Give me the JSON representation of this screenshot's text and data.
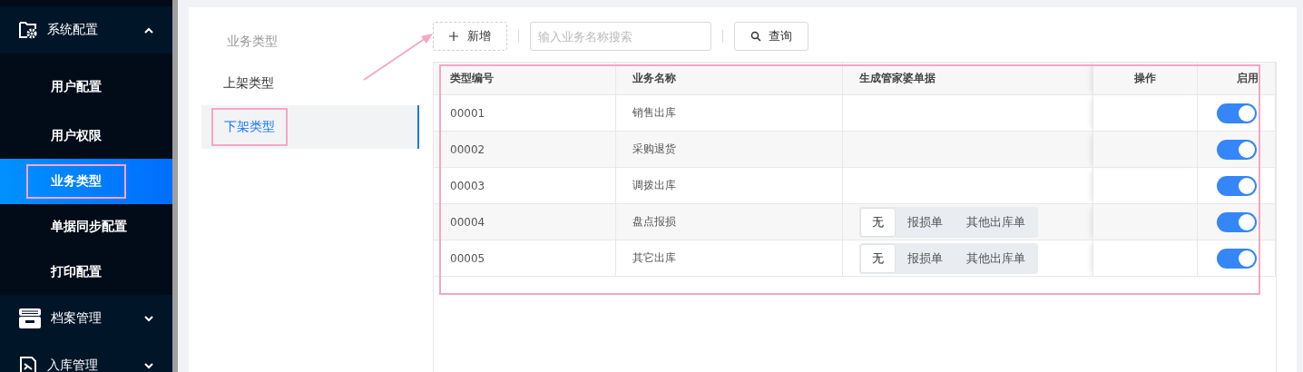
{
  "sidebar": {
    "groups": [
      {
        "label": "系统配置",
        "expanded": true,
        "children": [
          {
            "label": "用户配置",
            "selected": false,
            "highlighted": false
          },
          {
            "label": "用户权限",
            "selected": false,
            "highlighted": false
          },
          {
            "label": "业务类型",
            "selected": true,
            "highlighted": true
          },
          {
            "label": "单据同步配置",
            "selected": false,
            "highlighted": false
          },
          {
            "label": "打印配置",
            "selected": false,
            "highlighted": false
          }
        ]
      },
      {
        "label": "档案管理",
        "expanded": false
      },
      {
        "label": "入库管理",
        "expanded": false
      }
    ]
  },
  "submenu": {
    "title": "业务类型",
    "items": [
      {
        "label": "上架类型",
        "selected": false,
        "highlighted": false
      },
      {
        "label": "下架类型",
        "selected": true,
        "highlighted": true
      }
    ]
  },
  "annotation_arrow": true,
  "toolbar": {
    "add_button": "新增",
    "search": {
      "placeholder": "输入业务名称搜索"
    },
    "query_button": "查询"
  },
  "table": {
    "highlighted": true,
    "columns": [
      "类型编号",
      "业务名称",
      "生成管家婆单据",
      "操作",
      "启用"
    ],
    "rows": [
      {
        "code": "00001",
        "name": "销售出库",
        "enabled": true
      },
      {
        "code": "00002",
        "name": "采购退货",
        "enabled": true
      },
      {
        "code": "00003",
        "name": "调拨出库",
        "enabled": true
      },
      {
        "code": "00004",
        "name": "盘点报损",
        "doc_options": [
          {
            "label": "无",
            "selected": true
          },
          {
            "label": "报损单",
            "selected": false
          },
          {
            "label": "其他出库单",
            "selected": false
          }
        ],
        "enabled": true
      },
      {
        "code": "00005",
        "name": "其它出库",
        "doc_options": [
          {
            "label": "无",
            "selected": true
          },
          {
            "label": "报损单",
            "selected": false
          },
          {
            "label": "其他出库单",
            "selected": false
          }
        ],
        "enabled": true
      }
    ]
  }
}
